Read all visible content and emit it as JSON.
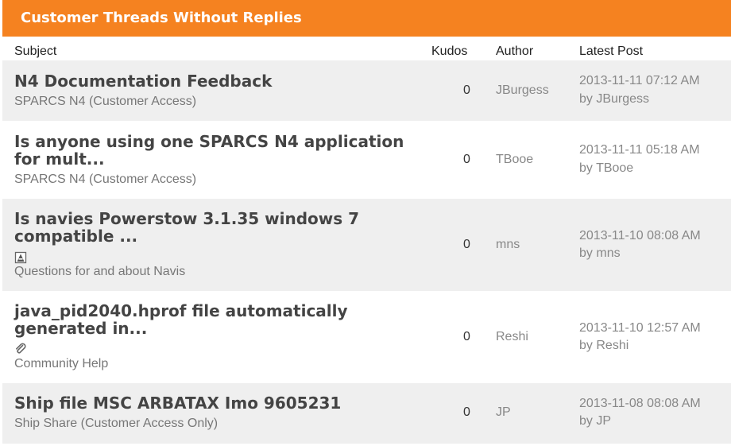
{
  "widget": {
    "title": "Customer Threads Without Replies",
    "accent_color": "#f58220"
  },
  "columns": {
    "subject": "Subject",
    "kudos": "Kudos",
    "author": "Author",
    "latest": "Latest Post"
  },
  "threads": [
    {
      "title": "N4 Documentation Feedback",
      "board": "SPARCS N4 (Customer Access)",
      "kudos": "0",
      "author": "JBurgess",
      "date": "2013-11-11 07:12 AM",
      "by_prefix": "by",
      "by_author": "JBurgess",
      "icon": null
    },
    {
      "title": "Is anyone using one SPARCS N4 application for mult...",
      "board": "SPARCS N4 (Customer Access)",
      "kudos": "0",
      "author": "TBooe",
      "date": "2013-11-11 05:18 AM",
      "by_prefix": "by",
      "by_author": "TBooe",
      "icon": null
    },
    {
      "title": "Is navies Powerstow 3.1.35 windows 7 compatible ...",
      "board": "Questions for and about Navis",
      "kudos": "0",
      "author": "mns",
      "date": "2013-11-10 08:08 AM",
      "by_prefix": "by",
      "by_author": "mns",
      "icon": "image-icon"
    },
    {
      "title": "java_pid2040.hprof file automatically generated in...",
      "board": "Community Help",
      "kudos": "0",
      "author": "Reshi",
      "date": "2013-11-10 12:57 AM",
      "by_prefix": "by",
      "by_author": "Reshi",
      "icon": "paperclip-icon"
    },
    {
      "title": "Ship file MSC ARBATAX Imo 9605231",
      "board": "Ship Share (Customer Access Only)",
      "kudos": "0",
      "author": "JP",
      "date": "2013-11-08 08:08 AM",
      "by_prefix": "by",
      "by_author": "JP",
      "icon": null
    }
  ]
}
